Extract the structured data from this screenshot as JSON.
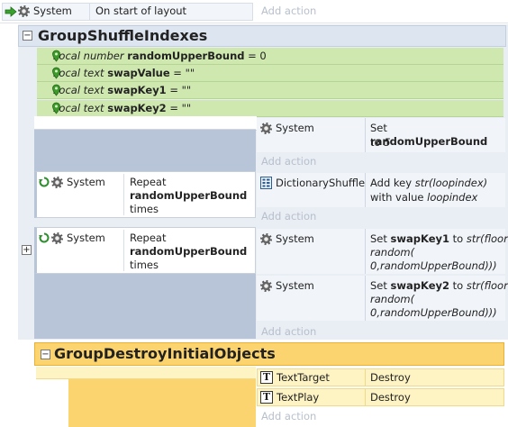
{
  "top_event": {
    "object": "System",
    "condition": "On start of layout",
    "add_action": "Add action"
  },
  "group1": {
    "title": "GroupShuffleIndexes",
    "collapse": "−"
  },
  "vars": [
    {
      "kind": "Local number",
      "name": "randomUpperBound",
      "rest": " = 0"
    },
    {
      "kind": "Local text",
      "name": "swapValue",
      "rest": " = \"\""
    },
    {
      "kind": "Local text",
      "name": "swapKey1",
      "rest": " = \"\""
    },
    {
      "kind": "Local text",
      "name": "swapKey2",
      "rest": " = \"\""
    }
  ],
  "ev_set": {
    "object": "System",
    "pre": "Set ",
    "bold": "randomUpperBound",
    "to": "to ",
    "val": "5",
    "add_action": "Add action"
  },
  "ev_repeat1": {
    "object": "System",
    "l1": "Repeat",
    "l2": "randomUpperBound",
    "l3": "times",
    "act_object": "DictionaryShuffle",
    "act_l1_pre": "Add key ",
    "act_l1_it": "str(loopindex)",
    "act_l2_pre": "with value ",
    "act_l2_it": "loopindex",
    "add_action": "Add action"
  },
  "ev_repeat2": {
    "object": "System",
    "l1": "Repeat",
    "l2": "randomUpperBound",
    "l3": "times",
    "expand": "+",
    "a1": {
      "object": "System",
      "pre": "Set ",
      "bold": "swapKey1",
      "to": " to ",
      "it1": "str(floor(",
      "it2": "random(",
      "it3": "0,randomUpperBound)))"
    },
    "a2": {
      "object": "System",
      "pre": "Set ",
      "bold": "swapKey2",
      "to": " to ",
      "it1": "str(floor(",
      "it2": "random(",
      "it3": "0,randomUpperBound)))"
    },
    "add_action": "Add action"
  },
  "group2": {
    "title": "GroupDestroyInitialObjects",
    "collapse": "−"
  },
  "destroy": [
    {
      "object": "TextTarget",
      "action": "Destroy"
    },
    {
      "object": "TextPlay",
      "action": "Destroy"
    }
  ],
  "add_action_end": "Add action",
  "colors": {
    "group_bg": "#dde5f0",
    "var_bg": "#cfe8b0",
    "group2_bg": "#fbd46f",
    "actions_bg": "#fef3c3"
  }
}
